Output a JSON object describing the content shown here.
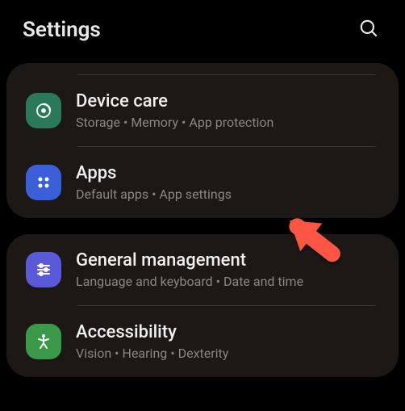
{
  "header": {
    "title": "Settings"
  },
  "groups": [
    {
      "items": [
        {
          "icon": "device-care-icon",
          "title": "Device care",
          "subtitle": "Storage  •  Memory  •  App protection"
        },
        {
          "icon": "apps-icon",
          "title": "Apps",
          "subtitle": "Default apps  •  App settings"
        }
      ]
    },
    {
      "items": [
        {
          "icon": "general-mgmt-icon",
          "title": "General management",
          "subtitle": "Language and keyboard  •  Date and time"
        },
        {
          "icon": "accessibility-icon",
          "title": "Accessibility",
          "subtitle": "Vision  •  Hearing  •  Dexterity"
        }
      ]
    }
  ]
}
